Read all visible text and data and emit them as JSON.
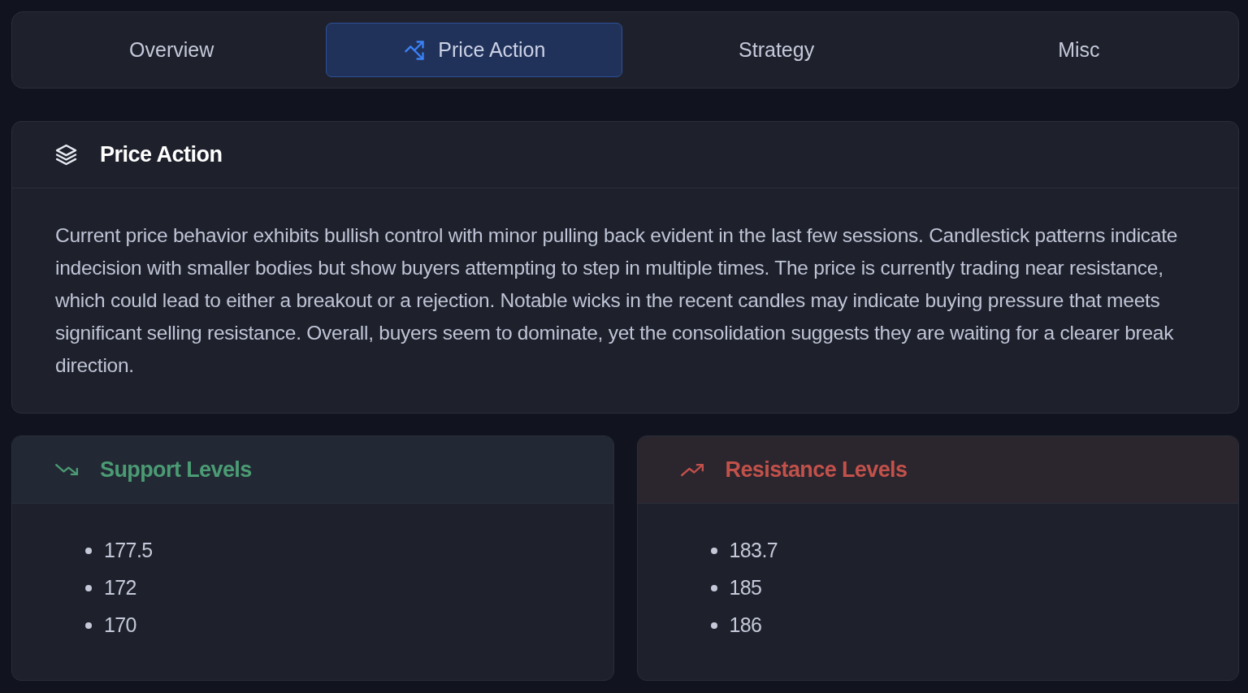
{
  "tabs": [
    {
      "label": "Overview",
      "selected": false
    },
    {
      "label": "Price Action",
      "selected": true
    },
    {
      "label": "Strategy",
      "selected": false
    },
    {
      "label": "Misc",
      "selected": false
    }
  ],
  "section": {
    "title": "Price Action",
    "text": "Current price behavior exhibits bullish control with minor pulling back evident in the last few sessions. Candlestick patterns indicate indecision with smaller bodies but show buyers attempting to step in multiple times. The price is currently trading near resistance, which could lead to either a breakout or a rejection. Notable wicks in the recent candles may indicate buying pressure that meets significant selling resistance. Overall, buyers seem to dominate, yet the consolidation suggests they are waiting for a clearer break direction."
  },
  "level_panels": [
    {
      "kind": "support",
      "title": "Support Levels",
      "levels": [
        "177.5",
        "172",
        "170"
      ]
    },
    {
      "kind": "resistance",
      "title": "Resistance Levels",
      "levels": [
        "183.7",
        "185",
        "186"
      ]
    }
  ]
}
